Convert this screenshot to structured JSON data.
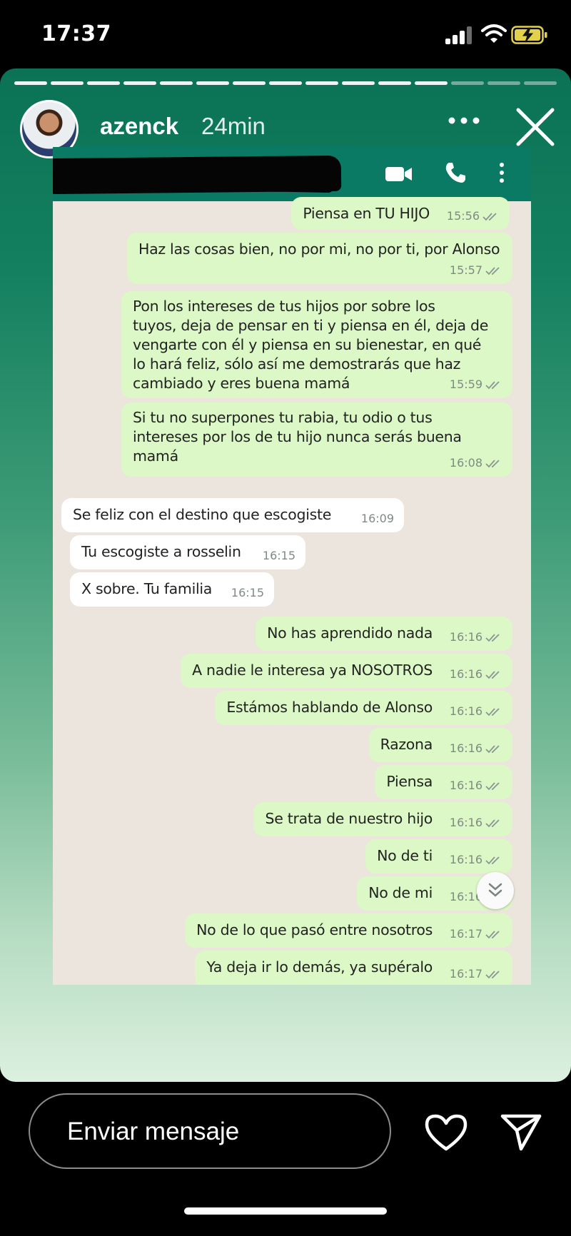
{
  "status_bar": {
    "time": "17:37"
  },
  "story": {
    "username": "azenck",
    "post_time": "24min",
    "segments_total": 15,
    "segments_seen": 12
  },
  "chat": {
    "messages": [
      {
        "dir": "out",
        "text": "Piensa en TU HIJO",
        "time": "15:56"
      },
      {
        "dir": "out",
        "text": "Haz las cosas bien, no por mi, no por ti, por Alonso",
        "time": "15:57"
      },
      {
        "dir": "out",
        "lines": [
          "Pon los intereses de tus hijos por sobre los",
          "tuyos, deja de pensar en ti y piensa en él, deja de",
          "vengarte con él y piensa en su bienestar, en qué",
          "lo hará feliz, sólo así me demostrarás que haz",
          "cambiado y eres buena mamá"
        ],
        "time": "15:59"
      },
      {
        "dir": "out",
        "lines": [
          "Si tu no superpones tu rabia, tu odio o tus",
          "intereses por los de tu hijo nunca serás buena",
          "mamá"
        ],
        "time": "16:08"
      },
      {
        "dir": "in",
        "text": "Se feliz con el destino que escogiste",
        "time": "16:09"
      },
      {
        "dir": "in",
        "text": "Tu escogiste a rosselin",
        "time": "16:15"
      },
      {
        "dir": "in",
        "text": "X sobre. Tu familia",
        "time": "16:15"
      },
      {
        "dir": "out",
        "text": "No has aprendido nada",
        "time": "16:16"
      },
      {
        "dir": "out",
        "text": "A nadie le interesa ya NOSOTROS",
        "time": "16:16"
      },
      {
        "dir": "out",
        "text": "Estámos hablando de Alonso",
        "time": "16:16"
      },
      {
        "dir": "out",
        "text": "Razona",
        "time": "16:16"
      },
      {
        "dir": "out",
        "text": "Piensa",
        "time": "16:16"
      },
      {
        "dir": "out",
        "text": "Se trata de nuestro hijo",
        "time": "16:16"
      },
      {
        "dir": "out",
        "text": "No de ti",
        "time": "16:16"
      },
      {
        "dir": "out",
        "text": "No de mi",
        "time": "16:16"
      },
      {
        "dir": "out",
        "text": "No de lo que pasó entre nosotros",
        "time": "16:17"
      },
      {
        "dir": "out",
        "text": "Ya deja ir lo demás, ya supéralo",
        "time": "16:17"
      }
    ]
  },
  "reply": {
    "placeholder": "Enviar mensaje"
  },
  "icons": {
    "video": "video-call-icon",
    "phone": "phone-call-icon",
    "menu": "kebab-menu-icon",
    "more": "more-options-icon",
    "close": "close-icon",
    "like": "heart-icon",
    "share": "send-icon"
  },
  "colors": {
    "out_bubble": "#dcf8c6",
    "in_bubble": "#ffffff",
    "chat_header": "#0b7a64",
    "tick": "#8b9690"
  }
}
